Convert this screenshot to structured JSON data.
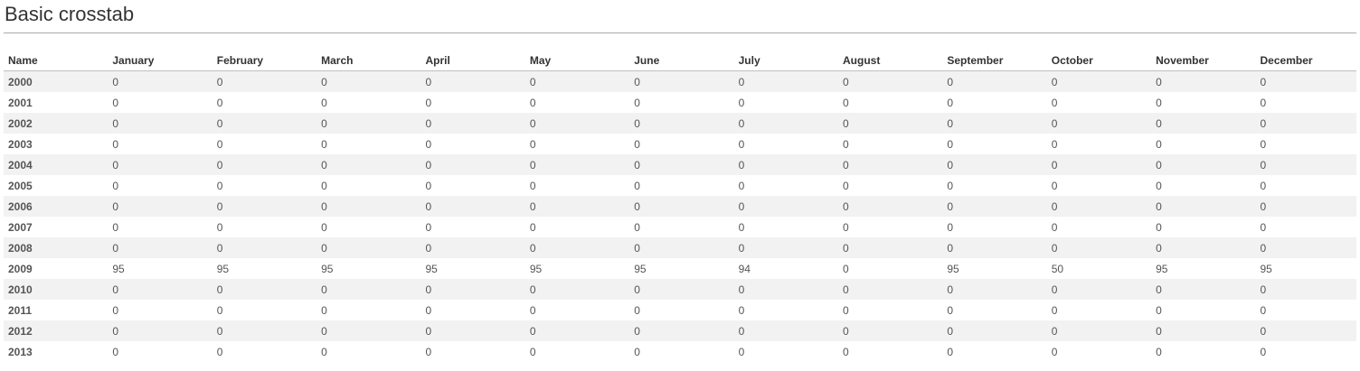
{
  "page": {
    "title": "Basic crosstab"
  },
  "table": {
    "columns": [
      "Name",
      "January",
      "February",
      "March",
      "April",
      "May",
      "June",
      "July",
      "August",
      "September",
      "October",
      "November",
      "December"
    ],
    "rows": [
      {
        "name": "2000",
        "values": [
          "0",
          "0",
          "0",
          "0",
          "0",
          "0",
          "0",
          "0",
          "0",
          "0",
          "0",
          "0"
        ]
      },
      {
        "name": "2001",
        "values": [
          "0",
          "0",
          "0",
          "0",
          "0",
          "0",
          "0",
          "0",
          "0",
          "0",
          "0",
          "0"
        ]
      },
      {
        "name": "2002",
        "values": [
          "0",
          "0",
          "0",
          "0",
          "0",
          "0",
          "0",
          "0",
          "0",
          "0",
          "0",
          "0"
        ]
      },
      {
        "name": "2003",
        "values": [
          "0",
          "0",
          "0",
          "0",
          "0",
          "0",
          "0",
          "0",
          "0",
          "0",
          "0",
          "0"
        ]
      },
      {
        "name": "2004",
        "values": [
          "0",
          "0",
          "0",
          "0",
          "0",
          "0",
          "0",
          "0",
          "0",
          "0",
          "0",
          "0"
        ]
      },
      {
        "name": "2005",
        "values": [
          "0",
          "0",
          "0",
          "0",
          "0",
          "0",
          "0",
          "0",
          "0",
          "0",
          "0",
          "0"
        ]
      },
      {
        "name": "2006",
        "values": [
          "0",
          "0",
          "0",
          "0",
          "0",
          "0",
          "0",
          "0",
          "0",
          "0",
          "0",
          "0"
        ]
      },
      {
        "name": "2007",
        "values": [
          "0",
          "0",
          "0",
          "0",
          "0",
          "0",
          "0",
          "0",
          "0",
          "0",
          "0",
          "0"
        ]
      },
      {
        "name": "2008",
        "values": [
          "0",
          "0",
          "0",
          "0",
          "0",
          "0",
          "0",
          "0",
          "0",
          "0",
          "0",
          "0"
        ]
      },
      {
        "name": "2009",
        "values": [
          "95",
          "95",
          "95",
          "95",
          "95",
          "95",
          "94",
          "0",
          "95",
          "50",
          "95",
          "95"
        ]
      },
      {
        "name": "2010",
        "values": [
          "0",
          "0",
          "0",
          "0",
          "0",
          "0",
          "0",
          "0",
          "0",
          "0",
          "0",
          "0"
        ]
      },
      {
        "name": "2011",
        "values": [
          "0",
          "0",
          "0",
          "0",
          "0",
          "0",
          "0",
          "0",
          "0",
          "0",
          "0",
          "0"
        ]
      },
      {
        "name": "2012",
        "values": [
          "0",
          "0",
          "0",
          "0",
          "0",
          "0",
          "0",
          "0",
          "0",
          "0",
          "0",
          "0"
        ]
      },
      {
        "name": "2013",
        "values": [
          "0",
          "0",
          "0",
          "0",
          "0",
          "0",
          "0",
          "0",
          "0",
          "0",
          "0",
          "0"
        ]
      }
    ]
  }
}
